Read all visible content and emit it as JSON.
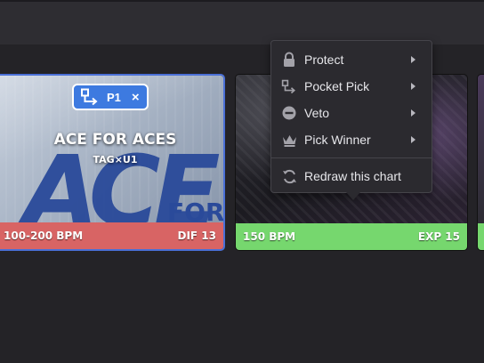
{
  "card1": {
    "title": "ACE FOR ACES",
    "subtitle": "TAG×U1",
    "bpm": "100-200 BPM",
    "difficulty": "DIF 13",
    "badge": {
      "label": "P1",
      "close": "×"
    },
    "art_letters": {
      "big": "ACE",
      "small": "FOR"
    }
  },
  "card2": {
    "bpm": "150 BPM",
    "difficulty": "EXP 15"
  },
  "menu": {
    "items": [
      {
        "label": "Protect",
        "icon": "lock-icon",
        "has_submenu": true
      },
      {
        "label": "Pocket Pick",
        "icon": "pocket-pick-icon",
        "has_submenu": true
      },
      {
        "label": "Veto",
        "icon": "veto-icon",
        "has_submenu": true
      },
      {
        "label": "Pick Winner",
        "icon": "crown-icon",
        "has_submenu": true
      }
    ],
    "redraw": {
      "label": "Redraw this chart",
      "icon": "refresh-icon"
    }
  },
  "colors": {
    "background": "#242327",
    "selected_border": "#4a6fd6",
    "badge": "#3d7ae0",
    "card1_footer": "#d86464",
    "card2_footer": "#76d76e",
    "menu_bg": "#2b2a2f"
  }
}
